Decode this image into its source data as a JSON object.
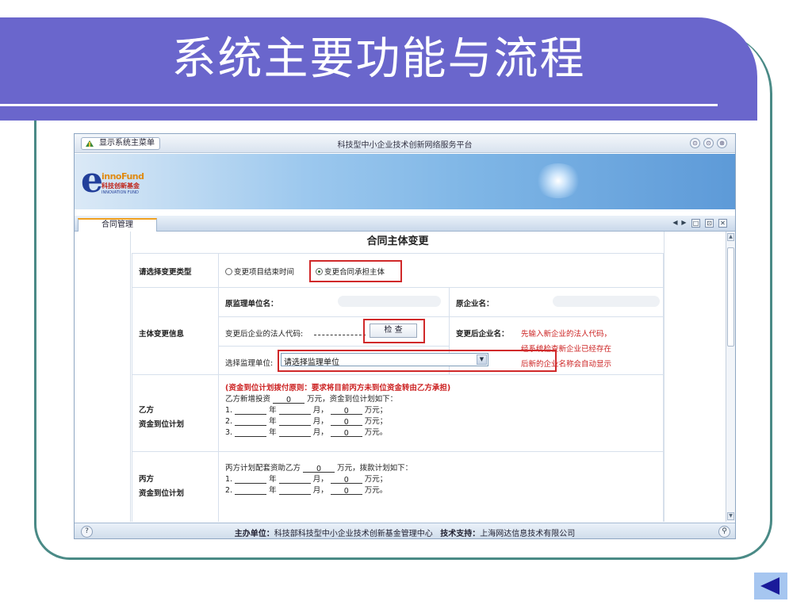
{
  "slide": {
    "title": "系统主要功能与流程"
  },
  "window": {
    "menu_button": "显示系统主菜单",
    "title": "科技型中小企业技术创新网络服务平台",
    "controls": [
      "⊙",
      "⊙",
      "⊗"
    ]
  },
  "header": {
    "logo_en": "innoFund",
    "logo_cn": "科技创新基金",
    "logo_sub": "INNOVATION FUND"
  },
  "tabs": {
    "active": "合同管理",
    "controls": [
      "◀",
      "▶",
      "□",
      "⊡",
      "✕"
    ]
  },
  "form": {
    "title": "合同主体变更",
    "type_label": "请选择变更类型",
    "type_options": [
      "变更项目结束时间",
      "变更合同承担主体"
    ],
    "info_label": "主体变更信息",
    "orig_unit_label": "原监理单位名：",
    "orig_company_label": "原企业名：",
    "new_code_label": "变更后企业的法人代码:",
    "check_button": "检 查",
    "new_company_label": "变更后企业名：",
    "new_company_note": [
      "先输入新企业的法人代码，",
      "经系统检查新企业已经存在",
      "后新的企业名称会自动显示"
    ],
    "supervisor_label": "选择监理单位:",
    "supervisor_value": "请选择监理单位",
    "partyB": {
      "label": [
        "乙方",
        "资金到位计划"
      ],
      "rule": "(资金到位计划拨付原则：要求将目前丙方未到位资金转由乙方承担)",
      "invest_prefix": "乙方新增投资",
      "invest_value": "0",
      "invest_suffix": "万元，资金到位计划如下：",
      "rows": [
        {
          "idx": "1.",
          "amount": "0",
          "end": "万元；"
        },
        {
          "idx": "2.",
          "amount": "0",
          "end": "万元；"
        },
        {
          "idx": "3.",
          "amount": "0",
          "end": "万元。"
        }
      ]
    },
    "partyC": {
      "label": [
        "丙方",
        "资金到位计划"
      ],
      "plan_prefix": "丙方计划配套资助乙方",
      "plan_value": "0",
      "plan_suffix": "万元，拨款计划如下：",
      "rows": [
        {
          "idx": "1.",
          "amount": "0",
          "end": "万元；"
        },
        {
          "idx": "2.",
          "amount": "0",
          "end": "万元。"
        }
      ]
    },
    "unit_year": "年",
    "unit_month": "月，"
  },
  "footer": {
    "host_label": "主办单位：",
    "host": "科技部科技型中小企业技术创新基金管理中心",
    "support_label": "技术支持：",
    "support": "上海网达信息技术有限公司",
    "icon_left": "?",
    "icon_right": "⚲"
  },
  "colors": {
    "banner": "#6a66cc",
    "frame": "#4a8a86",
    "highlight": "#d0292a",
    "nav": "#a6c6f0"
  },
  "icons": {
    "nav": "previous-slide-arrow-icon"
  }
}
